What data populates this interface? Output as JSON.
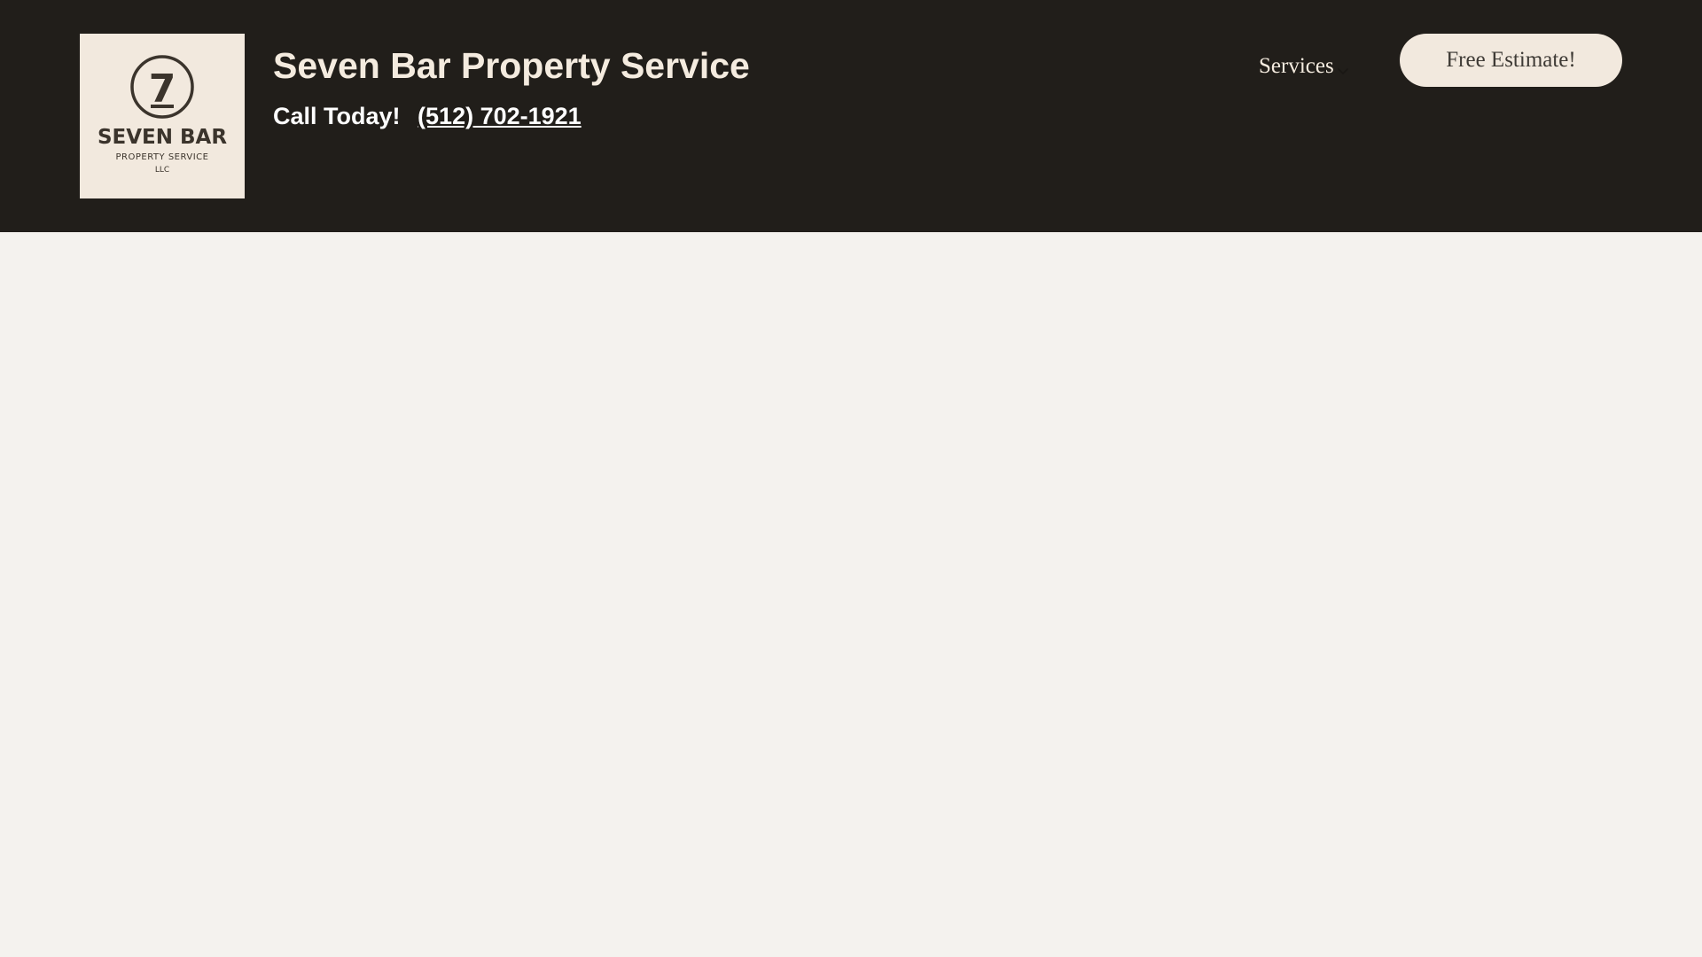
{
  "header": {
    "logo": {
      "numeral": "7",
      "name": "SEVEN BAR",
      "tagline": "PROPERTY SERVICE",
      "suffix": "LLC"
    },
    "site_title": "Seven Bar Property Service",
    "call_label": "Call Today!",
    "phone": "(512) 702-1921",
    "nav": {
      "services_label": "Services",
      "services_icon": "chevron-down-icon"
    },
    "cta_label": "Free Estimate!"
  },
  "colors": {
    "header_bg": "#211e1a",
    "page_bg": "#f4f2ee",
    "logo_bg": "#f2e9de",
    "brand_dark": "#3b342c",
    "title_text": "#f4ebdf"
  }
}
